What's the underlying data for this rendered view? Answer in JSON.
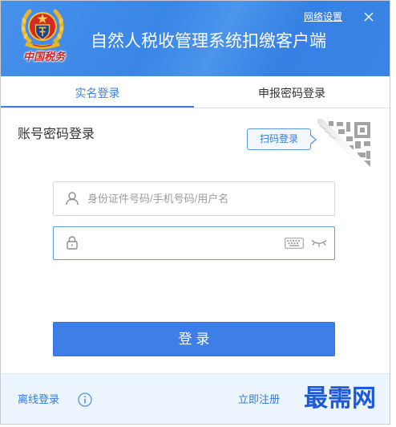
{
  "window": {
    "title": "自然人税收管理系统扣缴客户端",
    "network_settings": "网络设置"
  },
  "logo": {
    "caption": "中国税务"
  },
  "tabs": [
    {
      "label": "实名登录",
      "active": true
    },
    {
      "label": "申报密码登录",
      "active": false
    }
  ],
  "login": {
    "heading": "账号密码登录",
    "qr_login_label": "扫码登录",
    "username": {
      "value": "",
      "placeholder": "身份证件号码/手机号码/用户名"
    },
    "password": {
      "value": ""
    },
    "submit_label": "登 录"
  },
  "footer": {
    "offline_login": "离线登录",
    "register": "立即注册"
  },
  "watermark": "最需网",
  "icons": {
    "close": "close-icon",
    "user": "user-icon",
    "lock": "lock-icon",
    "keyboard": "keyboard-icon",
    "password_visibility": "eye-closed-icon",
    "info": "info-icon",
    "qr": "qr-code-icon",
    "emblem": "tax-emblem-icon"
  },
  "colors": {
    "header": "#3a86e6",
    "accent": "#3d7fe6",
    "link": "#2f7de0",
    "footer_bg": "#ecf4fd",
    "watermark": "#1f5ad6",
    "logo_red": "#d4241b"
  }
}
